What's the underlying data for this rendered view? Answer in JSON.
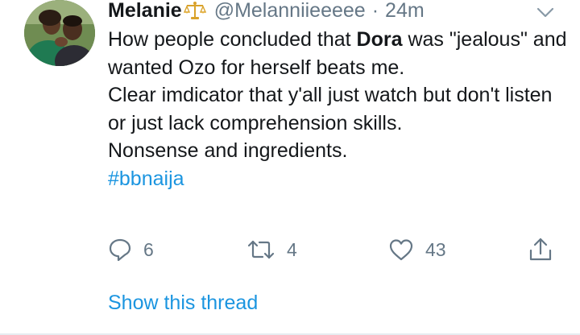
{
  "tweet": {
    "display_name": "Melanie",
    "name_emoji": "scales-icon",
    "handle": "@Melanniieeeee",
    "separator": "·",
    "time": "24m",
    "body": {
      "line1_before": "How people concluded that ",
      "line1_bold": "Dora",
      "line1_after": " was \"jealous\" and wanted Ozo for herself beats me.",
      "line2": "Clear imdicator that y'all just watch but don't listen or just lack comprehension skills.",
      "line3": "Nonsense and ingredients.",
      "hashtag": "#bbnaija"
    },
    "actions": {
      "reply_count": "6",
      "retweet_count": "4",
      "like_count": "43"
    },
    "show_thread": "Show this thread"
  },
  "colors": {
    "text": "#14171a",
    "secondary": "#657786",
    "link": "#1b95e0",
    "divider": "#e6ecf0"
  }
}
